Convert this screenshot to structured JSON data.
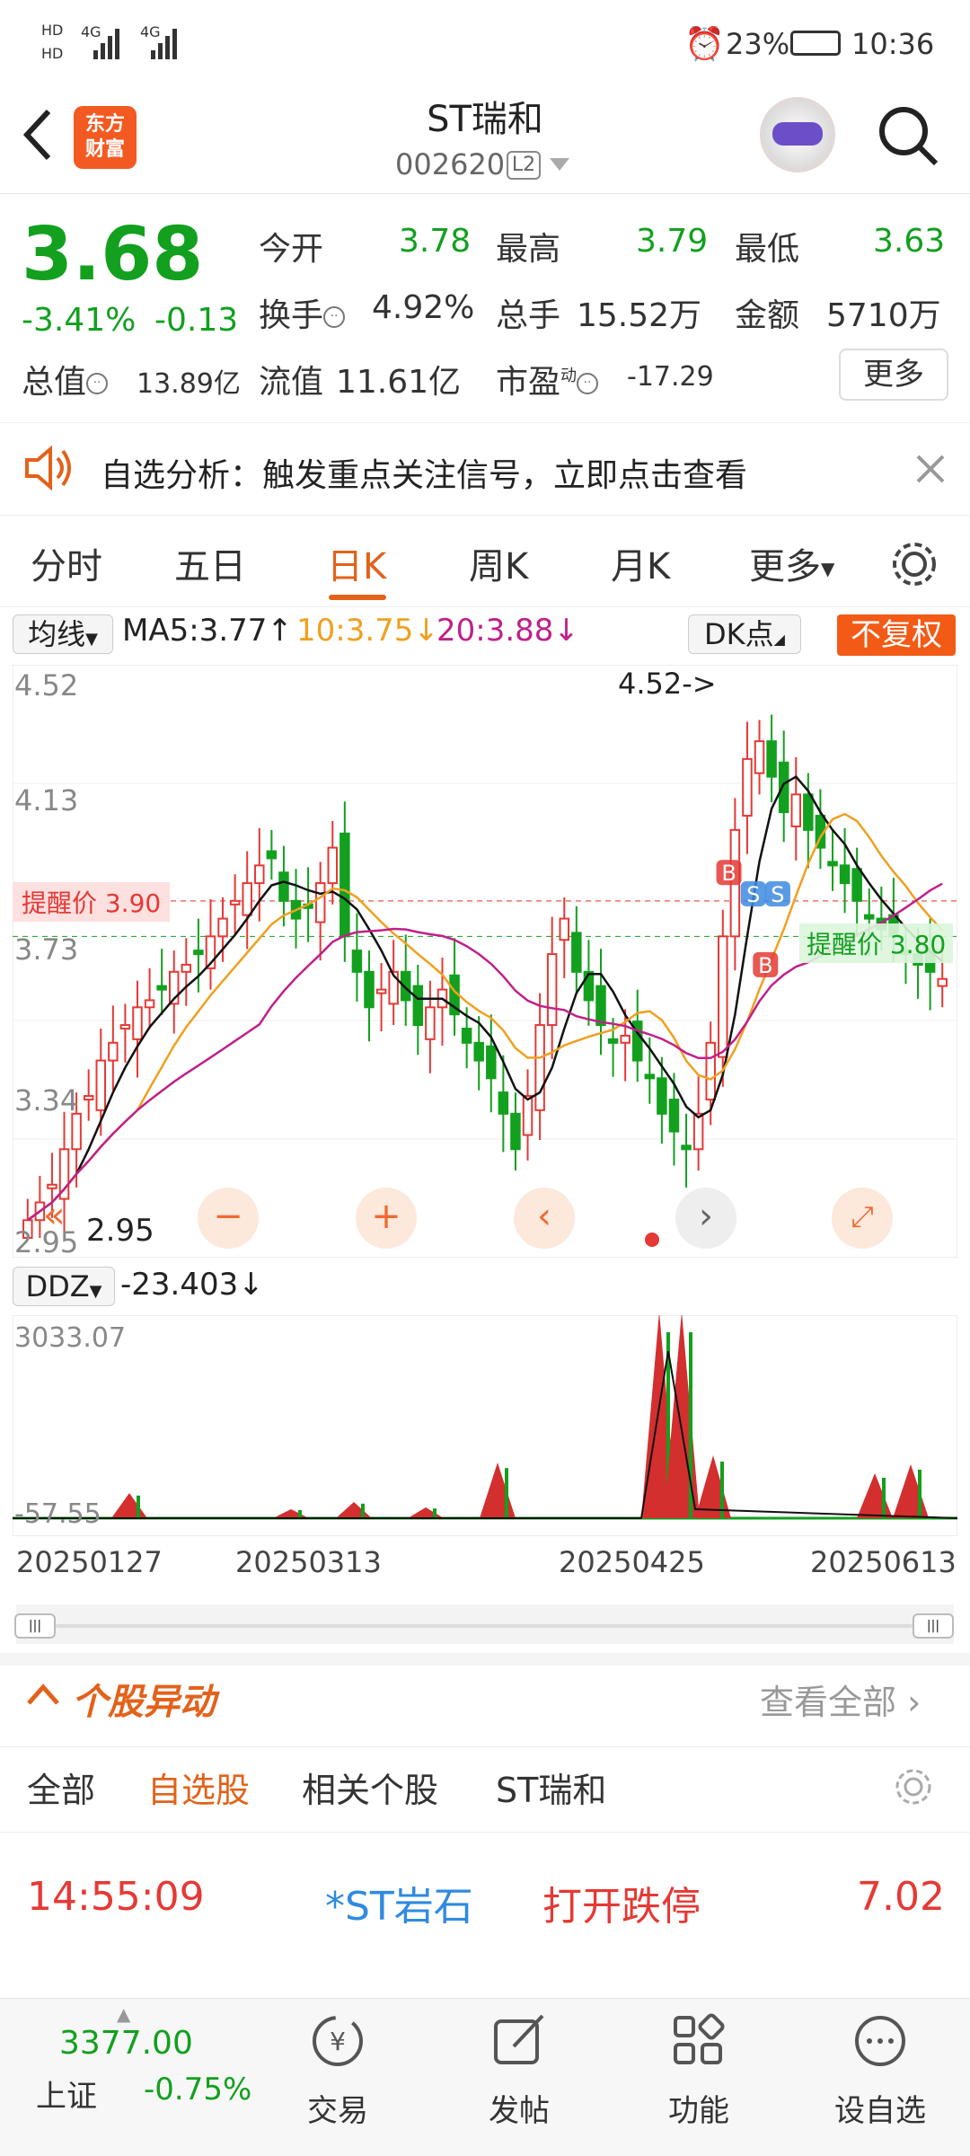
{
  "status": {
    "battery": "23%",
    "time": "10:36",
    "sig1": "HD",
    "sig2": "HD",
    "net1": "4G",
    "net2": "4G"
  },
  "header": {
    "logo": "东方\n财富",
    "logo_line1": "东方",
    "logo_line2": "财富",
    "title": "ST瑞和",
    "code": "002620",
    "level": "L2"
  },
  "quote": {
    "price": "3.68",
    "change_pct": "-3.41%",
    "change": "-0.13",
    "open_label": "今开",
    "open": "3.78",
    "high_label": "最高",
    "high": "3.79",
    "low_label": "最低",
    "low": "3.63",
    "turnover_label": "换手",
    "turnover": "4.92%",
    "volume_label": "总手",
    "volume": "15.52万",
    "amount_label": "金额",
    "amount": "5710万",
    "mktcap_label": "总值",
    "mktcap": "13.89亿",
    "float_label": "流值",
    "float": "11.61亿",
    "pe_label": "市盈",
    "pe_sup": "动",
    "pe": "-17.29",
    "more": "更多"
  },
  "notice": {
    "text": "自选分析：触发重点关注信号，立即点击查看"
  },
  "tabs": [
    "分时",
    "五日",
    "日K",
    "周K",
    "月K",
    "更多"
  ],
  "ma": {
    "selector": "均线",
    "ma5": "MA5:3.77",
    "ma10": "10:3.75",
    "ma20": "20:3.88",
    "dk": "DK点",
    "fq": "不复权"
  },
  "chart": {
    "ylabels": [
      "4.52",
      "4.13",
      "3.73",
      "3.34",
      "2.95"
    ],
    "max_note": "4.52->",
    "min_note": "2.95",
    "alert_red": "提醒价 3.90",
    "alert_green": "提醒价 3.80",
    "dates": [
      "20250127",
      "20250313",
      "20250425",
      "20250613"
    ],
    "ddz_label": "DDZ",
    "ddz_value": "-23.403",
    "ddz_top": "3033.07",
    "ddz_bottom": "-57.55"
  },
  "chart_data": {
    "type": "candlestick",
    "title": "ST瑞和 日K",
    "ylim": [
      2.95,
      4.52
    ],
    "x_start": "20250127",
    "x_end": "20250613",
    "ma": {
      "MA5": 3.77,
      "MA10": 3.75,
      "MA20": 3.88
    },
    "high_mark": 4.52,
    "low_mark": 2.95,
    "alert_prices": [
      3.9,
      3.8
    ],
    "close_series": [
      3.0,
      3.05,
      3.1,
      3.2,
      3.3,
      3.35,
      3.45,
      3.5,
      3.55,
      3.6,
      3.62,
      3.65,
      3.7,
      3.72,
      3.75,
      3.8,
      3.85,
      3.9,
      3.95,
      4.0,
      4.02,
      3.9,
      3.85,
      3.88,
      3.95,
      4.05,
      3.8,
      3.7,
      3.6,
      3.65,
      3.7,
      3.62,
      3.55,
      3.6,
      3.65,
      3.58,
      3.5,
      3.45,
      3.4,
      3.3,
      3.2,
      3.35,
      3.55,
      3.75,
      3.85,
      3.7,
      3.62,
      3.55,
      3.5,
      3.52,
      3.45,
      3.4,
      3.3,
      3.25,
      3.2,
      3.3,
      3.5,
      3.8,
      4.1,
      4.3,
      4.35,
      4.25,
      4.15,
      4.2,
      4.1,
      4.05,
      4.0,
      3.95,
      3.9,
      3.85,
      3.82,
      3.8,
      3.75,
      3.72,
      3.7,
      3.68
    ],
    "ddz": {
      "value": -23.403,
      "top": 3033.07,
      "bottom": -57.55
    }
  },
  "anomaly": {
    "title": "个股异动",
    "view_all": "查看全部",
    "subtabs": [
      "全部",
      "自选股",
      "相关个股",
      "ST瑞和"
    ],
    "row": {
      "time": "14:55:09",
      "name": "*ST岩石",
      "event": "打开跌停",
      "price": "7.02"
    }
  },
  "bottom": {
    "index_value": "3377.00",
    "index_name": "上证",
    "index_chg": "-0.75%",
    "nav": [
      "交易",
      "发帖",
      "功能",
      "设自选"
    ]
  },
  "colors": {
    "up": "#e53935",
    "down": "#12a01e",
    "accent": "#e2621a"
  }
}
